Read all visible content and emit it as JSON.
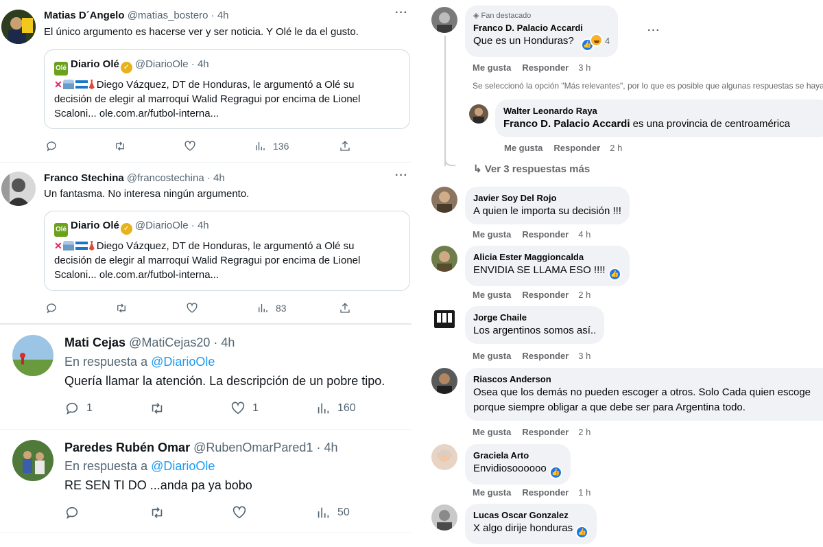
{
  "twitter": {
    "tweets": [
      {
        "name": "Matias D´Angelo",
        "handle": "@matias_bostero",
        "time": "4h",
        "text": "El único argumento es hacerse ver y ser noticia. Y Olé le da el gusto.",
        "quote": {
          "logo": "Olé",
          "name": "Diario Olé",
          "handle": "@DiarioOle",
          "time": "4h",
          "text_line1": "Diego Vázquez, DT de Honduras, le argumentó a Olé su",
          "text_line2": "decisión de elegir al marroquí Walid Regragui por encima de Lionel",
          "text_line3": "Scaloni... ole.com.ar/futbol-interna..."
        },
        "replies": "",
        "retweets": "",
        "likes": "",
        "views": "136"
      },
      {
        "name": "Franco Stechina",
        "handle": "@francostechina",
        "time": "4h",
        "text": "Un fantasma. No interesa ningún argumento.",
        "quote": {
          "logo": "Olé",
          "name": "Diario Olé",
          "handle": "@DiarioOle",
          "time": "4h",
          "text_line1": "Diego Vázquez, DT de Honduras, le argumentó a Olé su",
          "text_line2": "decisión de elegir al marroquí Walid Regragui por encima de Lionel",
          "text_line3": "Scaloni... ole.com.ar/futbol-interna..."
        },
        "replies": "",
        "retweets": "",
        "likes": "",
        "views": "83"
      },
      {
        "name": "Mati Cejas",
        "handle": "@MatiCejas20",
        "time": "4h",
        "reply_prefix": "En respuesta a",
        "reply_to": "@DiarioOle",
        "text": "Quería llamar la atención. La descripción de un pobre tipo.",
        "replies": "1",
        "retweets": "",
        "likes": "1",
        "views": "160"
      },
      {
        "name": "Paredes Rubén Omar",
        "handle": "@RubenOmarPared1",
        "time": "4h",
        "reply_prefix": "En respuesta a",
        "reply_to": "@DiarioOle",
        "text": "RE SEN TI DO ...anda pa ya bobo",
        "replies": "",
        "retweets": "",
        "likes": "",
        "views": "50"
      }
    ],
    "dot": "·"
  },
  "facebook": {
    "like_label": "Me gusta",
    "reply_label": "Responder",
    "comments": [
      {
        "badge": "Fan destacado",
        "name": "Franco D. Palacio Accardi",
        "text": "Que es un Honduras?",
        "reactions": "4",
        "time": "3 h"
      },
      {
        "name": "Walter Leonardo Raya",
        "mention": "Franco D. Palacio Accardi",
        "text": " es una provincia de centroamérica",
        "time": "2 h"
      },
      {
        "name": "Javier Soy Del Rojo",
        "text": "A quien le importa su decisión !!!",
        "time": "4 h"
      },
      {
        "name": "Alicia Ester Maggioncalda",
        "text": "ENVIDIA SE LLAMA ESO !!!!",
        "time": "2 h"
      },
      {
        "name": "Jorge Chaile",
        "text": "Los argentinos somos así..",
        "time": "3 h"
      },
      {
        "name": "Riascos Anderson",
        "text_line1": "Osea que los demás no pueden escoger a otros. Solo Cada quien escoge",
        "text_line2": "porque siempre obligar a que debe ser para Argentina todo.",
        "time": "2 h"
      },
      {
        "name": "Graciela Arto",
        "text": "Envidiosoooooo",
        "time": "1 h"
      },
      {
        "name": "Lucas Oscar Gonzalez",
        "text": "X algo dirije honduras"
      }
    ],
    "relevance_note": "Se seleccionó la opción \"Más relevantes\", por lo que es posible que algunas respuestas se hayan filtrado.",
    "view_more": "Ver 3 respuestas más"
  },
  "colors": {
    "twitter_link": "#1d9bf0",
    "twitter_gray": "#536471",
    "fb_bubble": "#f0f2f5",
    "fb_like": "#1877f2",
    "ole_green": "#6ba21d"
  }
}
